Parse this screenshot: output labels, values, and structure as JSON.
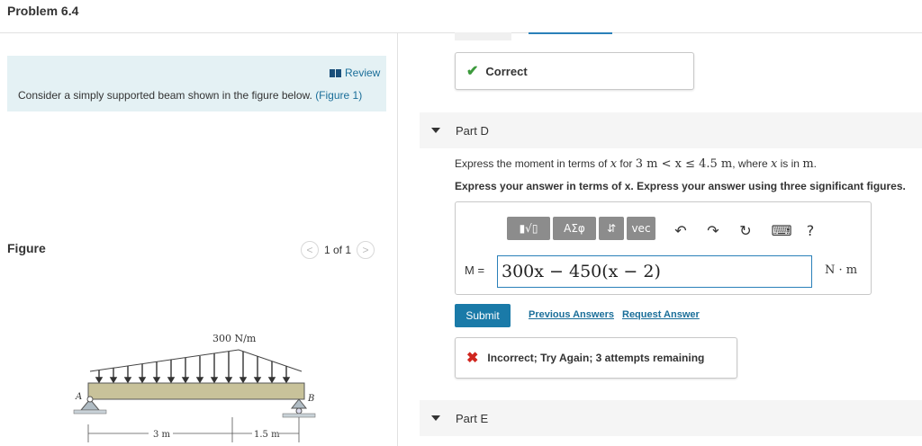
{
  "header": {
    "title": "Problem 6.4"
  },
  "review": {
    "link_label": "Review",
    "intro_text": "Consider a simply supported beam shown in the figure below. ",
    "figure_link": "(Figure 1)"
  },
  "figure": {
    "label": "Figure",
    "pager_text": "1 of 1",
    "prev_glyph": "<",
    "next_glyph": ">",
    "load_label": "300 N/m",
    "support_a_label": "A",
    "support_b_label": "B",
    "dim_left": "3 m",
    "dim_right": "1.5 m"
  },
  "feedback_prev": {
    "icon": "check-icon",
    "text": "Correct"
  },
  "part_d": {
    "label": "Part D",
    "prompt_pre": "Express the moment in terms of ",
    "prompt_var": "x",
    "prompt_mid": " for ",
    "prompt_range": "3 m < x ≤ 4.5 m",
    "prompt_where": ", where ",
    "prompt_var2": "x",
    "prompt_post": " is in ",
    "prompt_unit": "m",
    "prompt_end": ".",
    "instruction": "Express your answer in terms of x. Express your answer using three significant figures.",
    "toolbar": {
      "templates_label": "▮√▯",
      "symbols_label": "ΑΣφ",
      "arrows_label": "⇵",
      "vec_label": "vec",
      "undo_glyph": "↶",
      "redo_glyph": "↷",
      "reset_glyph": "↻",
      "keyboard_glyph": "⌨",
      "help_glyph": "?"
    },
    "answer_label": "M =",
    "answer_value": "300x − 450(x − 2)",
    "unit": "N · m",
    "submit_label": "Submit",
    "previous_answers_label": "Previous Answers",
    "request_answer_label": "Request Answer",
    "result": {
      "icon": "x-icon",
      "text": "Incorrect; Try Again; 3 attempts remaining"
    }
  },
  "part_e": {
    "label": "Part E"
  },
  "colors": {
    "accent": "#1a7aa8",
    "review_bg": "#e4f1f4",
    "correct": "#3c9a3c",
    "incorrect": "#d0261f"
  }
}
